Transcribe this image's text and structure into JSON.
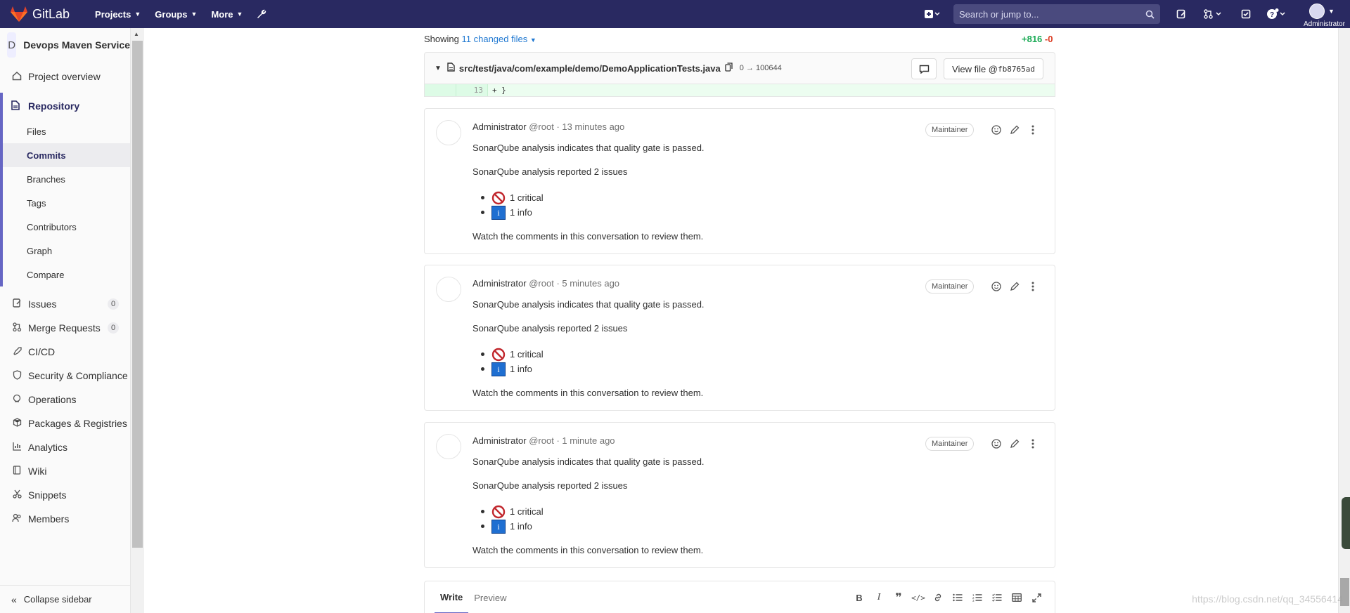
{
  "navbar": {
    "brand": "GitLab",
    "menu": [
      {
        "label": "Projects"
      },
      {
        "label": "Groups"
      },
      {
        "label": "More"
      }
    ],
    "search_placeholder": "Search or jump to...",
    "user_name": "Administrator",
    "colors": {
      "bg": "#292961",
      "logo": "#e24329"
    }
  },
  "sidebar": {
    "project_avatar": "D",
    "project_name": "Devops Maven Service",
    "project_overview": "Project overview",
    "repository": {
      "label": "Repository",
      "items": [
        "Files",
        "Commits",
        "Branches",
        "Tags",
        "Contributors",
        "Graph",
        "Compare"
      ],
      "active": "Commits"
    },
    "items": [
      {
        "label": "Issues",
        "count": "0",
        "icon": "issues-icon"
      },
      {
        "label": "Merge Requests",
        "count": "0",
        "icon": "merge-request-icon"
      },
      {
        "label": "CI/CD",
        "icon": "rocket-icon"
      },
      {
        "label": "Security & Compliance",
        "icon": "shield-icon"
      },
      {
        "label": "Operations",
        "icon": "cloud-icon"
      },
      {
        "label": "Packages & Registries",
        "icon": "package-icon"
      },
      {
        "label": "Analytics",
        "icon": "chart-icon"
      },
      {
        "label": "Wiki",
        "icon": "book-icon"
      },
      {
        "label": "Snippets",
        "icon": "scissors-icon"
      },
      {
        "label": "Members",
        "icon": "users-icon"
      }
    ],
    "collapse": "Collapse sidebar"
  },
  "diff": {
    "showing_prefix": "Showing",
    "changed_files": "11 changed files",
    "additions": "+816",
    "deletions": "-0",
    "file_path": "src/test/java/com/example/demo/DemoApplicationTests.java",
    "file_mode": "0 → 100644",
    "view_file": "View file @",
    "commit_sha": "fb8765ad",
    "line_number": "13",
    "line_code": "+ }"
  },
  "notes": [
    {
      "author": "Administrator",
      "handle": "@root",
      "time": "· 13 minutes ago",
      "role": "Maintainer",
      "line1": "SonarQube analysis indicates that quality gate is passed.",
      "line2": "SonarQube analysis reported 2 issues",
      "critical": "1 critical",
      "info": "1 info",
      "footer": "Watch the comments in this conversation to review them."
    },
    {
      "author": "Administrator",
      "handle": "@root",
      "time": "· 5 minutes ago",
      "role": "Maintainer",
      "line1": "SonarQube analysis indicates that quality gate is passed.",
      "line2": "SonarQube analysis reported 2 issues",
      "critical": "1 critical",
      "info": "1 info",
      "footer": "Watch the comments in this conversation to review them."
    },
    {
      "author": "Administrator",
      "handle": "@root",
      "time": "· 1 minute ago",
      "role": "Maintainer",
      "line1": "SonarQube analysis indicates that quality gate is passed.",
      "line2": "SonarQube analysis reported 2 issues",
      "critical": "1 critical",
      "info": "1 info",
      "footer": "Watch the comments in this conversation to review them."
    }
  ],
  "editor": {
    "tab_write": "Write",
    "tab_preview": "Preview"
  },
  "watermark": "https://blog.csdn.net/qq_34556414"
}
